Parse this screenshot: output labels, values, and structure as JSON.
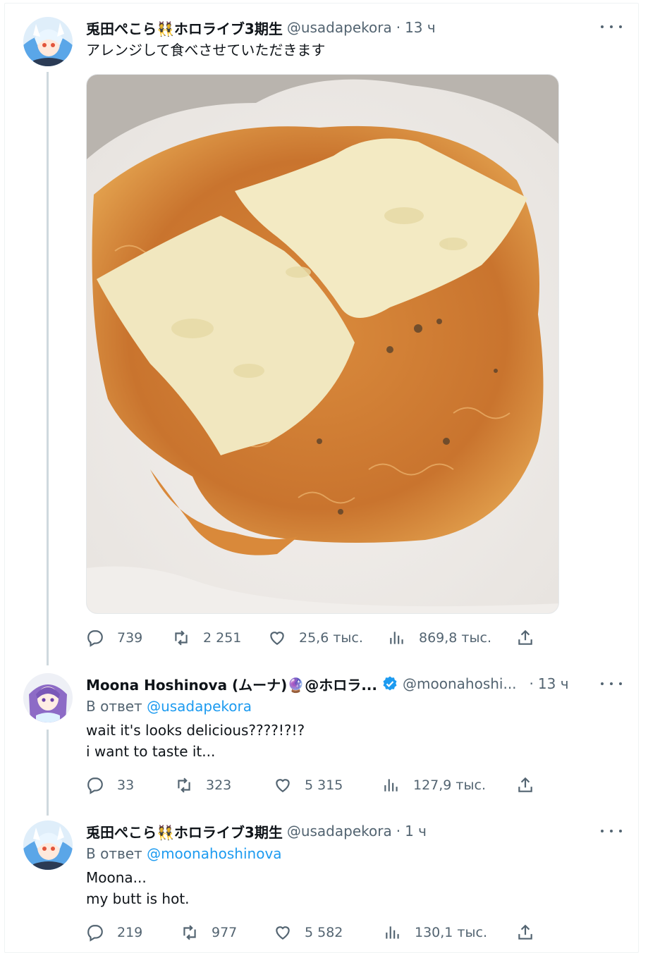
{
  "tweets": [
    {
      "author_name": "兎田ぺこら👯ホロライブ3期生",
      "handle": "@usadapekora",
      "separator": "·",
      "time": "13 ч",
      "text": "アレンジして食べさせていただきます",
      "replies": "739",
      "retweets": "2 251",
      "likes": "25,6 тыс.",
      "views": "869,8 тыс.",
      "avatar_icon": "pekora-avatar",
      "media": "photo of fried instant-noodle pancake with melted cheese on white plate"
    },
    {
      "author_name": "Moona Hoshinova (ムーナ)🔮@ホロラ...",
      "handle": "@moonahoshi...",
      "separator": "·",
      "time": "13 ч",
      "replying_prefix": "В ответ",
      "replying_to": "@usadapekora",
      "text": "wait it's looks delicious????!?!?\ni want to taste it...",
      "replies": "33",
      "retweets": "323",
      "likes": "5 315",
      "views": "127,9 тыс.",
      "avatar_icon": "moona-avatar",
      "verified_icon": "verified-badge-icon"
    },
    {
      "author_name": "兎田ぺこら👯ホロライブ3期生",
      "handle": "@usadapekora",
      "separator": "·",
      "time": "1 ч",
      "replying_prefix": "В ответ",
      "replying_to": "@moonahoshinova",
      "text": "Moona...\nmy butt is hot.",
      "replies": "219",
      "retweets": "977",
      "likes": "5 582",
      "views": "130,1 тыс.",
      "avatar_icon": "pekora-avatar"
    }
  ],
  "colors": {
    "link": "#1d9bf0",
    "secondary": "#536471",
    "thread_line": "#cfd9de",
    "verified": "#1d9bf0"
  },
  "icons": [
    "reply-icon",
    "retweet-icon",
    "like-icon",
    "views-icon",
    "share-icon",
    "more-icon"
  ]
}
